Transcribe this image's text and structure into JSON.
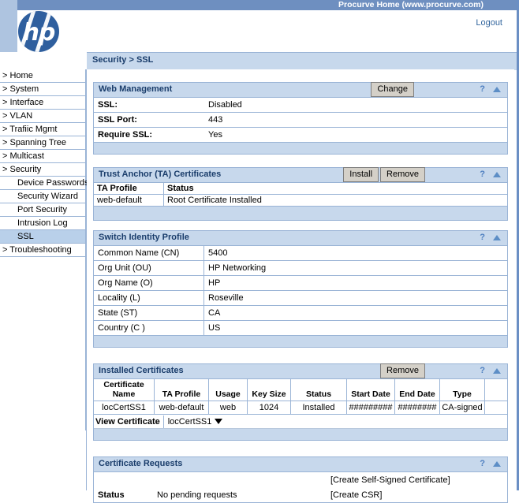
{
  "topbar": {
    "procurve_link": "Procurve Home (www.procurve.com)",
    "logout": "Logout",
    "logo_letters": "hp"
  },
  "breadcrumb": "Security > SSL",
  "sidebar": {
    "items": [
      {
        "label": "> Home",
        "level": "top",
        "selected": false
      },
      {
        "label": "> System",
        "level": "top",
        "selected": false
      },
      {
        "label": "> Interface",
        "level": "top",
        "selected": false
      },
      {
        "label": "> VLAN",
        "level": "top",
        "selected": false
      },
      {
        "label": "> Trafiic Mgmt",
        "level": "top",
        "selected": false
      },
      {
        "label": "> Spanning Tree",
        "level": "top",
        "selected": false
      },
      {
        "label": "> Multicast",
        "level": "top",
        "selected": false
      },
      {
        "label": "> Security",
        "level": "top",
        "selected": false
      },
      {
        "label": "Device Passwords",
        "level": "child",
        "selected": false
      },
      {
        "label": "Security Wizard",
        "level": "child",
        "selected": false
      },
      {
        "label": "Port Security",
        "level": "child",
        "selected": false
      },
      {
        "label": "Intrusion Log",
        "level": "child",
        "selected": false
      },
      {
        "label": "SSL",
        "level": "child",
        "selected": true
      },
      {
        "label": "> Troubleshooting",
        "level": "top",
        "selected": false
      }
    ]
  },
  "panels": {
    "web_management": {
      "title": "Web Management",
      "change_button": "Change",
      "help_icon": "?",
      "collapse_icon": "collapse-triangle",
      "rows": [
        {
          "key": "SSL:",
          "value": "Disabled"
        },
        {
          "key": "SSL Port:",
          "value": "443"
        },
        {
          "key": "Require SSL:",
          "value": "Yes"
        }
      ]
    },
    "trust_anchor": {
      "title": "Trust Anchor (TA) Certificates",
      "install_button": "Install",
      "remove_button": "Remove",
      "help_icon": "?",
      "collapse_icon": "collapse-triangle",
      "columns": [
        "TA Profile",
        "Status"
      ],
      "rows": [
        [
          "web-default",
          "Root Certificate Installed"
        ]
      ]
    },
    "switch_identity": {
      "title": "Switch Identity Profile",
      "help_icon": "?",
      "collapse_icon": "collapse-triangle",
      "rows": [
        {
          "key": "Common Name (CN)",
          "value": "5400"
        },
        {
          "key": "Org Unit (OU)",
          "value": "HP Networking"
        },
        {
          "key": "Org Name (O)",
          "value": "HP"
        },
        {
          "key": "Locality (L)",
          "value": "Roseville"
        },
        {
          "key": "State (ST)",
          "value": "CA"
        },
        {
          "key": "Country (C )",
          "value": "US"
        }
      ]
    },
    "installed_certificates": {
      "title": "Installed Certificates",
      "remove_button": "Remove",
      "help_icon": "?",
      "collapse_icon": "collapse-triangle",
      "columns": [
        "Certificate Name",
        "TA Profile",
        "Usage",
        "Key Size",
        "Status",
        "Start Date",
        "End Date",
        "Type",
        ""
      ],
      "rows": [
        [
          "locCertSS1",
          "web-default",
          "web",
          "1024",
          "Installed",
          "#########",
          "########",
          "CA-signed",
          ""
        ]
      ],
      "view_certificate_label": "View Certificate",
      "view_certificate_value": "locCertSS1",
      "dropdown_icon": "caret-down-icon"
    },
    "certificate_requests": {
      "title": "Certificate Requests",
      "help_icon": "?",
      "collapse_icon": "collapse-triangle",
      "create_self_signed_link": "[Create Self-Signed Certificate]",
      "create_csr_link": "[Create CSR]",
      "status_label": "Status",
      "status_value": "No pending requests"
    }
  },
  "colors": {
    "banner_blue": "#6e8fc0",
    "panel_header": "#c7d8ec",
    "border_blue": "#9ab4d6",
    "selected_nav": "#b9d0ea",
    "link_blue": "#33669e",
    "icon_blue": "#5d8ec6",
    "logo_blue": "#2f5f9e"
  }
}
